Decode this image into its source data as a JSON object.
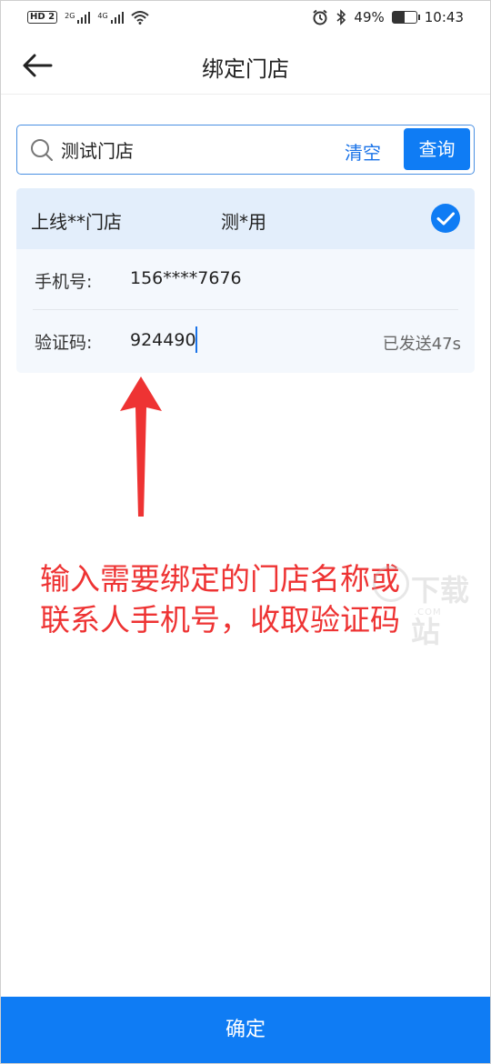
{
  "status_bar": {
    "hd_badge": "HD 2",
    "network_1": "2G",
    "network_2": "4G",
    "battery_percent": "49%",
    "battery_level": 0.49,
    "time": "10:43"
  },
  "header": {
    "title": "绑定门店"
  },
  "search": {
    "value": "测试门店",
    "clear_label": "清空",
    "query_label": "查询"
  },
  "store": {
    "name": "上线**门店",
    "contact": "测*用",
    "selected": true,
    "phone_label": "手机号:",
    "phone_value": "156****7676",
    "code_label": "验证码:",
    "code_value": "924490",
    "sent_status": "已发送47s"
  },
  "annotation": {
    "line1": "输入需要绑定的门店名称或",
    "line2": "联系人手机号，收取验证码"
  },
  "watermark": {
    "text": "下载站",
    "sub": ".COM"
  },
  "footer": {
    "confirm_label": "确定"
  },
  "colors": {
    "accent": "#0f7cf4",
    "annotation": "#ee3333",
    "selected_bg": "#e3eefb",
    "card_bg": "#f4f8fd"
  },
  "icons": {
    "back": "arrow-left-icon",
    "search": "search-icon",
    "check": "check-circle-icon"
  }
}
